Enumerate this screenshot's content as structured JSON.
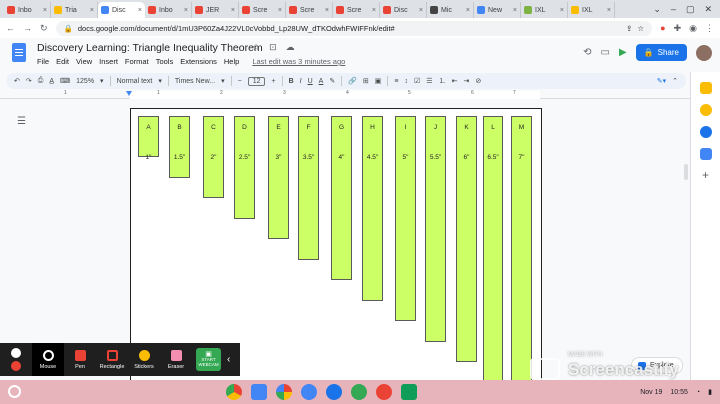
{
  "browser": {
    "tabs": [
      {
        "label": "Inbo",
        "color": "#ea4335"
      },
      {
        "label": "Tria",
        "color": "#fbbc04"
      },
      {
        "label": "Disc",
        "color": "#4285f4",
        "active": true
      },
      {
        "label": "Inbo",
        "color": "#ea4335"
      },
      {
        "label": "JER",
        "color": "#ea4335"
      },
      {
        "label": "Scre",
        "color": "#ea4335"
      },
      {
        "label": "Scre",
        "color": "#ea4335"
      },
      {
        "label": "Scre",
        "color": "#ea4335"
      },
      {
        "label": "Disc",
        "color": "#ea4335"
      },
      {
        "label": "Mic",
        "color": "#444"
      },
      {
        "label": "New",
        "color": "#4285f4"
      },
      {
        "label": "IXL",
        "color": "#7cb342"
      },
      {
        "label": "IXL",
        "color": "#fbbc04"
      }
    ],
    "close_glyph": "×",
    "url": "docs.google.com/document/d/1mU3P60Za4J22VL0cVobbd_Lp28UW_dTKOdwhFWIFFnk/edit#"
  },
  "doc": {
    "title": "Discovery Learning: Triangle Inequality Theorem",
    "menus": [
      "File",
      "Edit",
      "View",
      "Insert",
      "Format",
      "Tools",
      "Extensions",
      "Help"
    ],
    "last_edit": "Last edit was 3 minutes ago",
    "share_label": "Share"
  },
  "toolbar": {
    "zoom": "125%",
    "style": "Normal text",
    "font": "Times New...",
    "size": "12",
    "bold": "B",
    "italic": "I",
    "underline": "U",
    "text_color": "A"
  },
  "ruler": {
    "numbers": [
      "1",
      "1",
      "2",
      "3",
      "4",
      "5",
      "6",
      "7"
    ]
  },
  "strips": [
    {
      "letter": "A",
      "length": "1\""
    },
    {
      "letter": "B",
      "length": "1.5\""
    },
    {
      "letter": "C",
      "length": "2\""
    },
    {
      "letter": "D",
      "length": "2.5\""
    },
    {
      "letter": "E",
      "length": "3\""
    },
    {
      "letter": "F",
      "length": "3.5\""
    },
    {
      "letter": "G",
      "length": "4\""
    },
    {
      "letter": "H",
      "length": "4.5\""
    },
    {
      "letter": "I",
      "length": "5\""
    },
    {
      "letter": "J",
      "length": "5.5\""
    },
    {
      "letter": "K",
      "length": "6\""
    },
    {
      "letter": "L",
      "length": "6.5\""
    },
    {
      "letter": "M",
      "length": "7\""
    }
  ],
  "explore_label": "Explore",
  "recorder": {
    "tools": [
      {
        "label": "Mouse",
        "color": "#ffffff"
      },
      {
        "label": "Pen",
        "color": "#ea4335"
      },
      {
        "label": "Rectangle",
        "color": "#ea4335"
      },
      {
        "label": "Stickers",
        "color": "#fbbc04"
      },
      {
        "label": "Eraser",
        "color": "#f48fb1"
      }
    ],
    "webcam_label": "START WEBCAM"
  },
  "watermark": {
    "made_with": "MADE WITH",
    "brand": "Screencastify"
  },
  "shelf": {
    "date": "Nov 19",
    "time": "10:55"
  }
}
